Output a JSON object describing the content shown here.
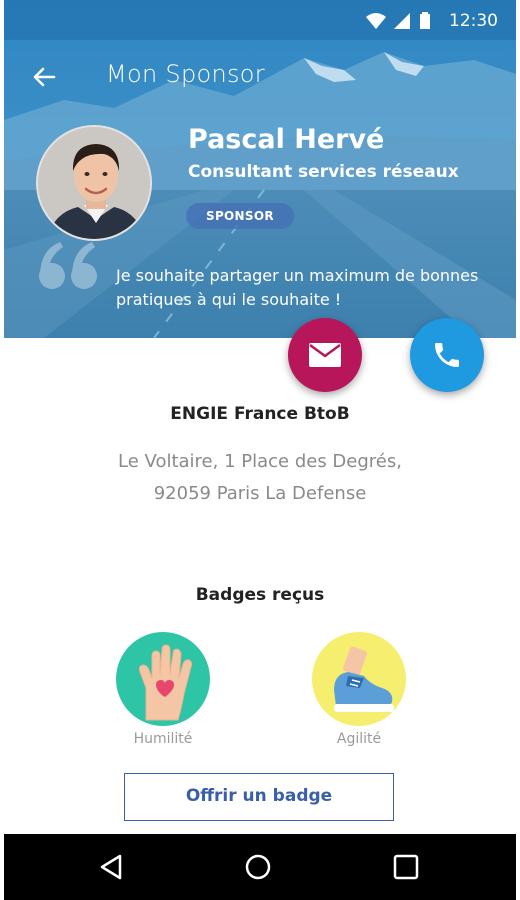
{
  "status_bar": {
    "time": "12:30"
  },
  "header": {
    "title": "Mon Sponsor",
    "name": "Pascal Hervé",
    "role": "Consultant services réseaux",
    "badge": "SPONSOR",
    "quote": "Je souhaite partager un maximum de bonnes pratiques à qui le souhaite !"
  },
  "contact": {
    "company": "ENGIE France BtoB",
    "address_line1": "Le Voltaire, 1 Place des Degrés,",
    "address_line2": "92059 Paris La Defense"
  },
  "badges": {
    "title": "Badges reçus",
    "items": [
      {
        "label": "Humilité",
        "icon": "hand-heart-icon",
        "color": "#2ec4a6"
      },
      {
        "label": "Agilité",
        "icon": "sneaker-icon",
        "color": "#f6ee6e"
      }
    ],
    "offer_label": "Offrir un badge"
  },
  "colors": {
    "mail_fab": "#b8165a",
    "phone_fab": "#1f9ae0",
    "accent": "#3a5fa8"
  }
}
